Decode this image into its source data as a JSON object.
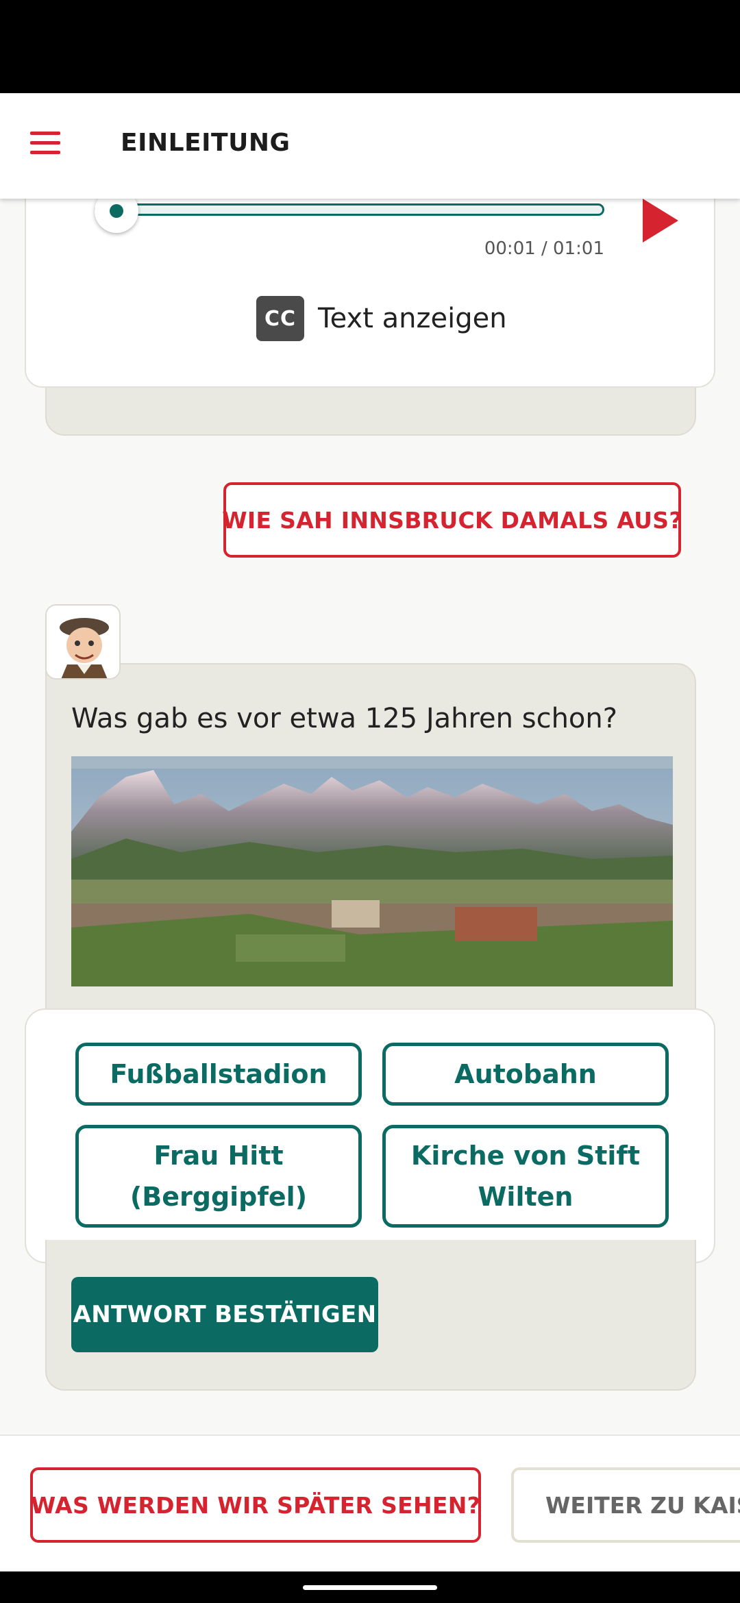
{
  "header": {
    "title": "EINLEITUNG"
  },
  "audio": {
    "time": "00:01 / 01:01",
    "progress": 0.016,
    "cc_label": "Text anzeigen",
    "cc_icon": "CC"
  },
  "reply_button_1": "WIE SAH INNSBRUCK DAMALS AUS?",
  "question": {
    "text": "Was gab es vor etwa 125 Jahren schon?",
    "image": "panorama postcard of Innsbruck with mountains"
  },
  "answers": [
    {
      "label": "Fußballstadion"
    },
    {
      "label": "Autobahn"
    },
    {
      "label": "Frau Hitt (Berggipfel)"
    },
    {
      "label": "Kirche von Stift Wilten"
    }
  ],
  "confirm_button": "ANTWORT BESTÄTIGEN",
  "bottom_actions": {
    "left": "WAS WERDEN WIR SPÄTER SEHEN?",
    "right": "WEITER ZU KAISER"
  },
  "colors": {
    "accent_red": "#d5232f",
    "teal": "#0b6b62",
    "bubble": "#e9e8e1"
  },
  "icons": [
    "menu-icon",
    "play-icon",
    "cc-icon",
    "avatar-boy"
  ]
}
